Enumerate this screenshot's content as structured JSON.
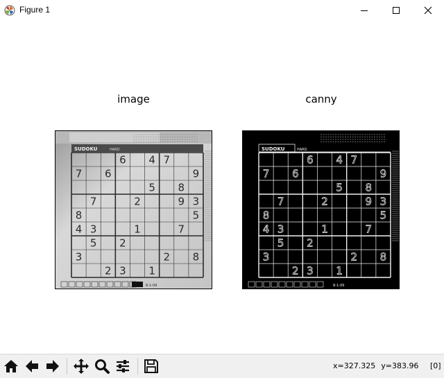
{
  "window": {
    "title": "Figure 1",
    "app_icon": "matplotlib-icon",
    "controls": [
      "minimize-icon",
      "maximize-icon",
      "close-icon"
    ]
  },
  "figure": {
    "axes": [
      {
        "title": "image"
      },
      {
        "title": "canny"
      }
    ],
    "puzzle": {
      "header": "SUDOKU",
      "level": "HARD",
      "date": "8-1-09",
      "grid": [
        [
          "",
          "",
          "",
          "6",
          "",
          "4",
          "7",
          "",
          ""
        ],
        [
          "7",
          "",
          "6",
          "",
          "",
          "",
          "",
          "",
          "9"
        ],
        [
          "",
          "",
          "",
          "",
          "",
          "5",
          "",
          "8",
          ""
        ],
        [
          "",
          "7",
          "",
          "",
          "2",
          "",
          "",
          "9",
          "3"
        ],
        [
          "8",
          "",
          "",
          "",
          "",
          "",
          "",
          "",
          "5"
        ],
        [
          "4",
          "3",
          "",
          "",
          "1",
          "",
          "",
          "7",
          ""
        ],
        [
          "",
          "5",
          "",
          "2",
          "",
          "",
          "",
          "",
          ""
        ],
        [
          "3",
          "",
          "",
          "",
          "",
          "",
          "2",
          "",
          "8"
        ],
        [
          "",
          "",
          "2",
          "3",
          "",
          "1",
          "",
          "",
          ""
        ]
      ]
    },
    "colors": {
      "paper": "#d9d9d9",
      "ink": "#2a2a2a",
      "edges": "#f2f2f2",
      "edge_background": "#000000"
    }
  },
  "toolbar": {
    "buttons": [
      "home-icon",
      "back-icon",
      "forward-icon",
      "pan-icon",
      "zoom-icon",
      "configure-subplots-icon",
      "save-icon"
    ],
    "x_readout": "x=327.325",
    "y_readout": "y=383.96",
    "pixel_value": "[0]"
  }
}
